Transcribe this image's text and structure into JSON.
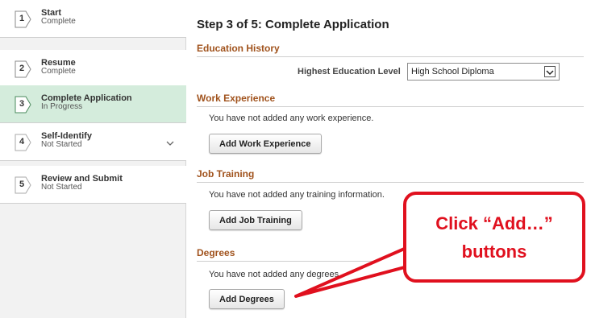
{
  "steps": [
    {
      "number": "1",
      "title": "Start",
      "status": "Complete"
    },
    {
      "number": "2",
      "title": "Resume",
      "status": "Complete"
    },
    {
      "number": "3",
      "title": "Complete Application",
      "status": "In Progress"
    },
    {
      "number": "4",
      "title": "Self-Identify",
      "status": "Not Started"
    },
    {
      "number": "5",
      "title": "Review and Submit",
      "status": "Not Started"
    }
  ],
  "page_title": "Step 3 of 5: Complete Application",
  "education": {
    "heading": "Education History",
    "field_label": "Highest Education Level",
    "selected_value": "High School Diploma"
  },
  "work": {
    "heading": "Work Experience",
    "message": "You have not added any work experience.",
    "button": "Add Work Experience"
  },
  "training": {
    "heading": "Job Training",
    "message": "You have not added any training information.",
    "button": "Add Job Training"
  },
  "degrees": {
    "heading": "Degrees",
    "message": "You have not added any degrees.",
    "button": "Add Degrees"
  },
  "callout": {
    "line1": "Click “Add…”",
    "line2": "buttons"
  },
  "colors": {
    "active_step": "#d4ecdc",
    "section_heading": "#a0521c",
    "callout": "#e0101e"
  }
}
